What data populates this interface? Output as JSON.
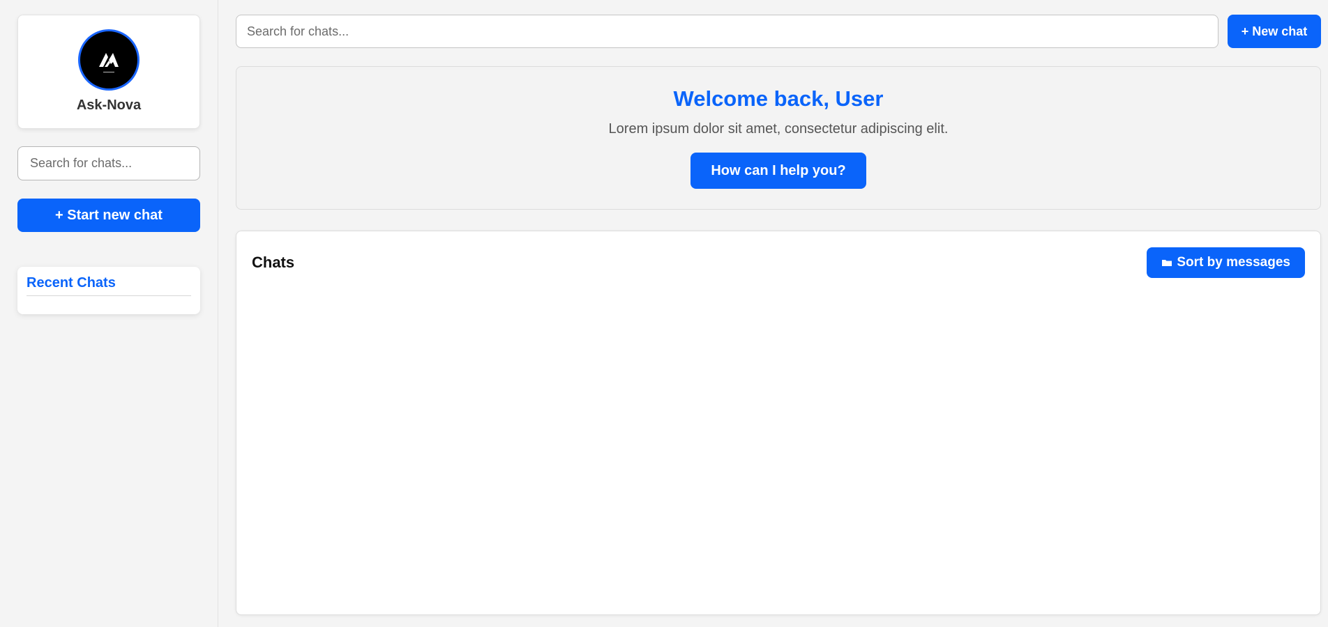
{
  "sidebar": {
    "app_name": "Ask-Nova",
    "search_placeholder": "Search for chats...",
    "start_chat_label": "+ Start new chat",
    "recent_chats_title": "Recent Chats",
    "recent_chats": []
  },
  "top_bar": {
    "search_placeholder": "Search for chats...",
    "new_chat_label": "+ New chat"
  },
  "welcome": {
    "title": "Welcome back, User",
    "subtitle": "Lorem ipsum dolor sit amet, consectetur adipiscing elit.",
    "help_label": "How can I help you?"
  },
  "chats": {
    "title": "Chats",
    "sort_label": "Sort by messages",
    "sort_icon": "folder-icon",
    "items": []
  },
  "colors": {
    "accent": "#0a64fa",
    "background": "#f4f4f4",
    "panel": "#ffffff"
  }
}
